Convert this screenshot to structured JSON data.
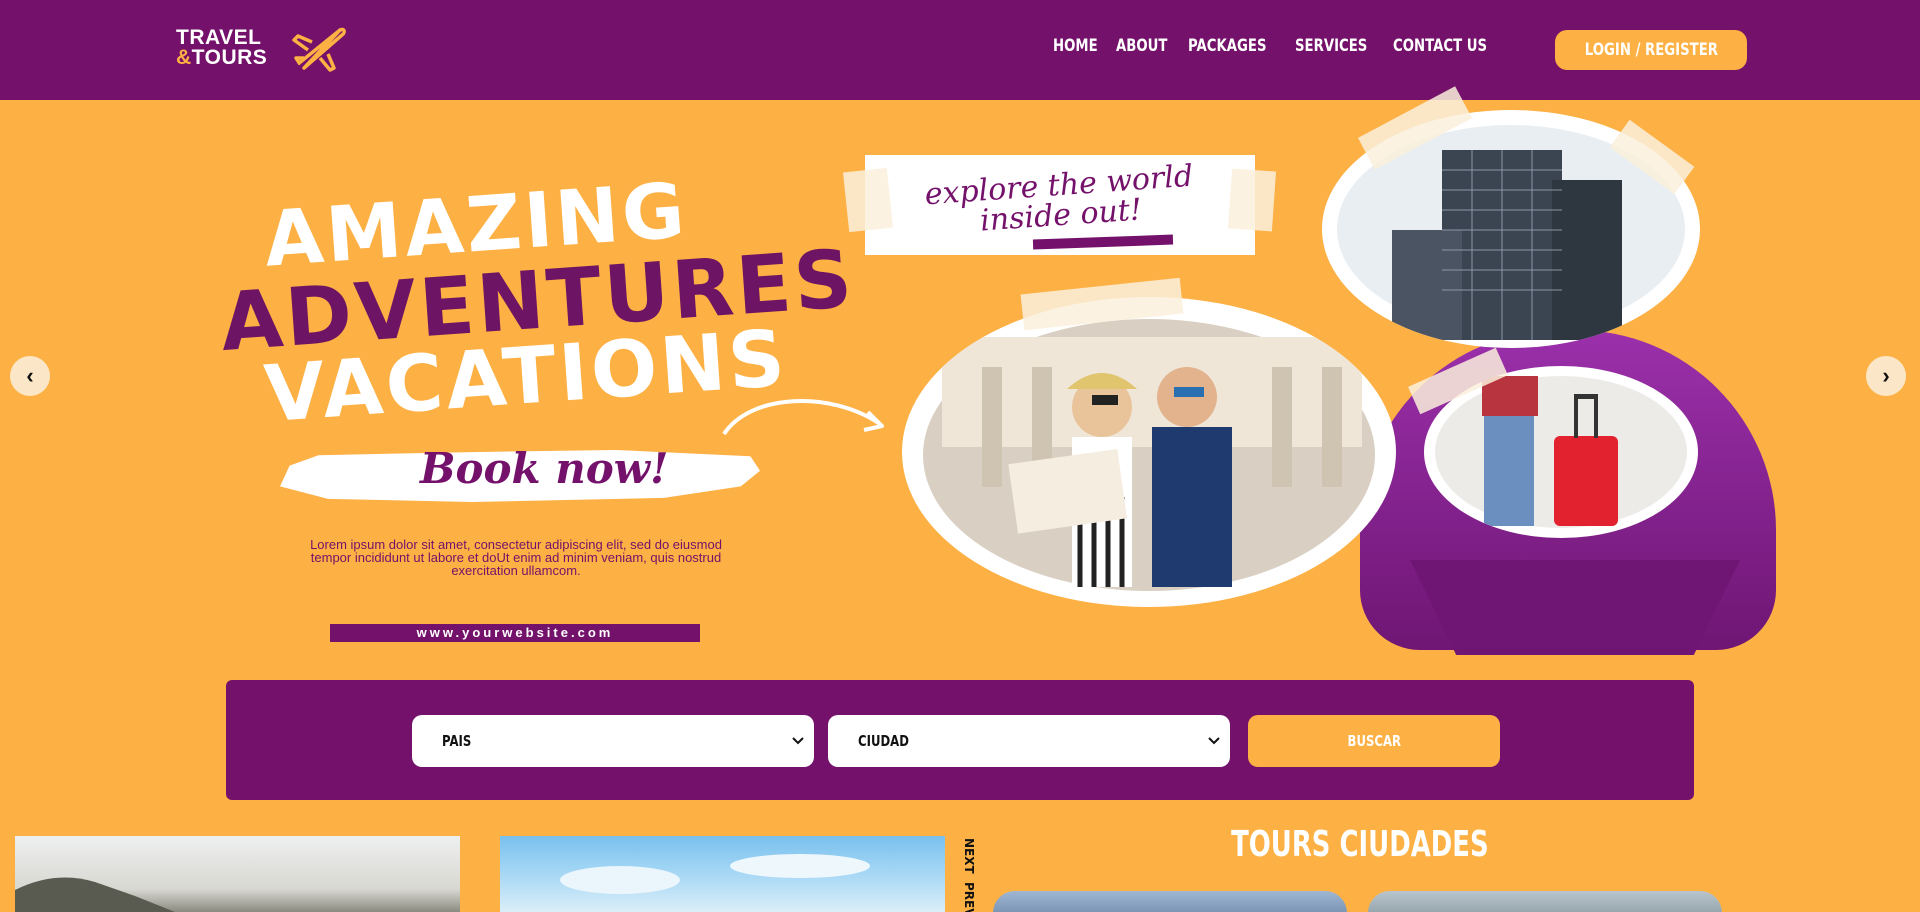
{
  "brand": {
    "line1": "TRAVEL",
    "line2_amp": "&",
    "line2": "TOURS",
    "accent_color": "#fdb043",
    "primary_color": "#74116a"
  },
  "nav": {
    "items": [
      "HOME",
      "ABOUT",
      "PACKAGES",
      "SERVICES",
      "CONTACT US"
    ],
    "login_label": "LOGIN / REGISTER"
  },
  "hero": {
    "headline_1": "AMAZING",
    "headline_2": "ADVENTURES",
    "headline_3": "VACATIONS",
    "cta": "Book now!",
    "tagline": "explore the world inside out!",
    "lorem": "Lorem ipsum dolor sit amet, consectetur adipiscing elit, sed do eiusmod tempor incididunt ut labore et doUt enim ad minim veniam, quis nostrud exercitation ullamcom.",
    "website": "www.yourwebsite.com",
    "prev_icon": "chevron-left-icon",
    "next_icon": "chevron-right-icon"
  },
  "search": {
    "country_value": "PAIS",
    "city_value": "CIUDAD",
    "button_label": "BUSCAR"
  },
  "carousel": {
    "next_label": "NEXT",
    "prev_label": "PREV"
  },
  "tours": {
    "title": "TOURS CIUDADES"
  }
}
